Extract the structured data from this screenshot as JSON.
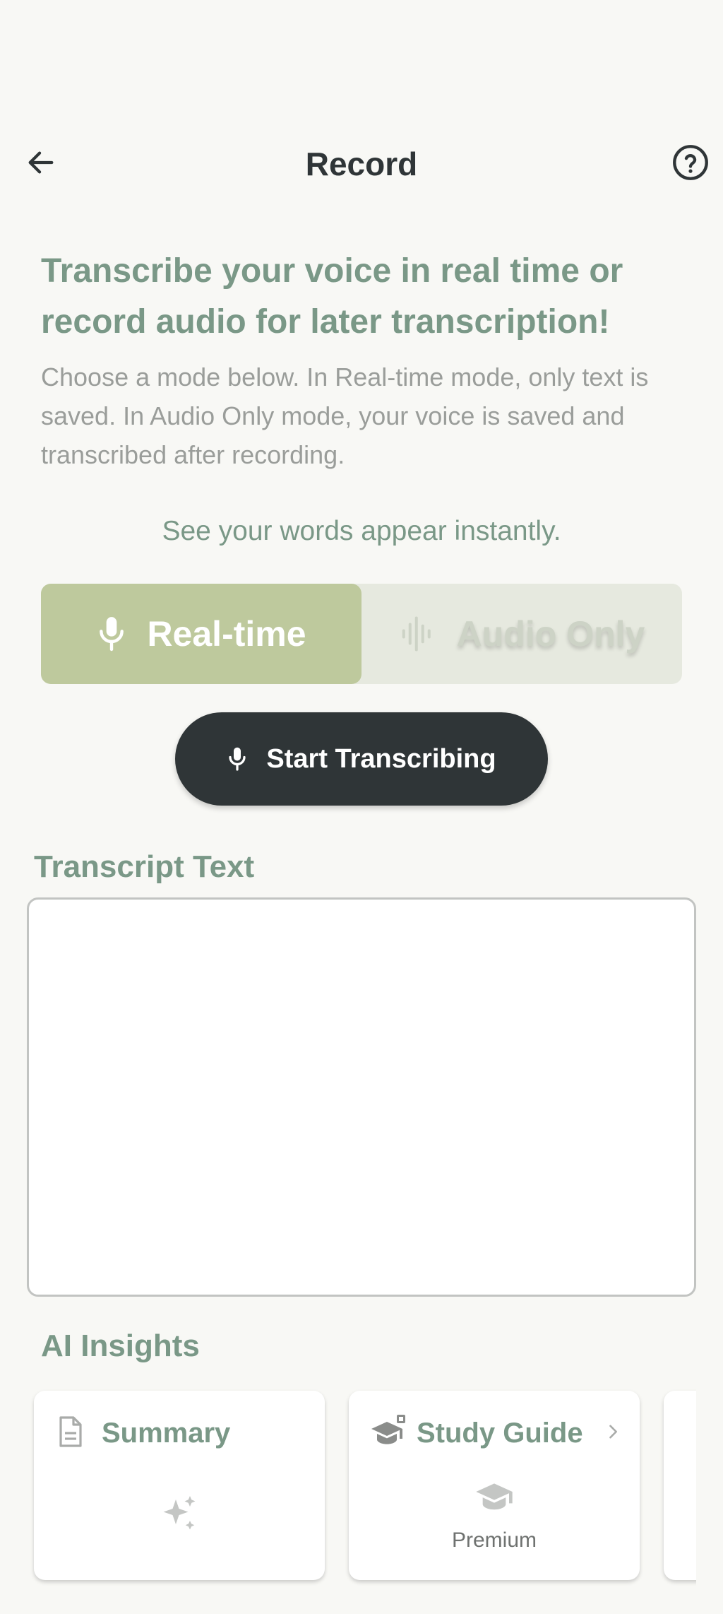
{
  "header": {
    "title": "Record",
    "back_icon": "arrow-left-icon",
    "help_icon": "help-circle-icon"
  },
  "intro": {
    "headline": "Transcribe your voice in real time or record audio for later transcription!",
    "description": "Choose a mode below. In Real-time mode, only text is saved. In Audio Only mode, your voice is saved and transcribed after recording.",
    "mode_caption": "See your words appear instantly."
  },
  "mode_toggle": {
    "selected": "Real-time",
    "options": [
      {
        "label": "Real-time",
        "icon": "microphone-icon"
      },
      {
        "label": "Audio Only",
        "icon": "waveform-icon"
      }
    ]
  },
  "start_button": {
    "label": "Start Transcribing",
    "icon": "microphone-icon"
  },
  "transcript": {
    "label": "Transcript Text",
    "value": ""
  },
  "insights": {
    "label": "AI Insights",
    "cards": [
      {
        "title": "Summary",
        "icon": "document-icon",
        "content_icon": "sparkles-icon"
      },
      {
        "title": "Study Guide",
        "icon": "graduation-cap-icon",
        "content_icon": "graduation-cap-icon",
        "badge": "Premium",
        "chevron": "chevron-right-icon"
      }
    ]
  },
  "colors": {
    "background": "#f8f8f5",
    "accent_green": "#7a9887",
    "toggle_selected": "#bec99d",
    "toggle_track": "#e6e9df",
    "dark_button": "#2f3537"
  }
}
